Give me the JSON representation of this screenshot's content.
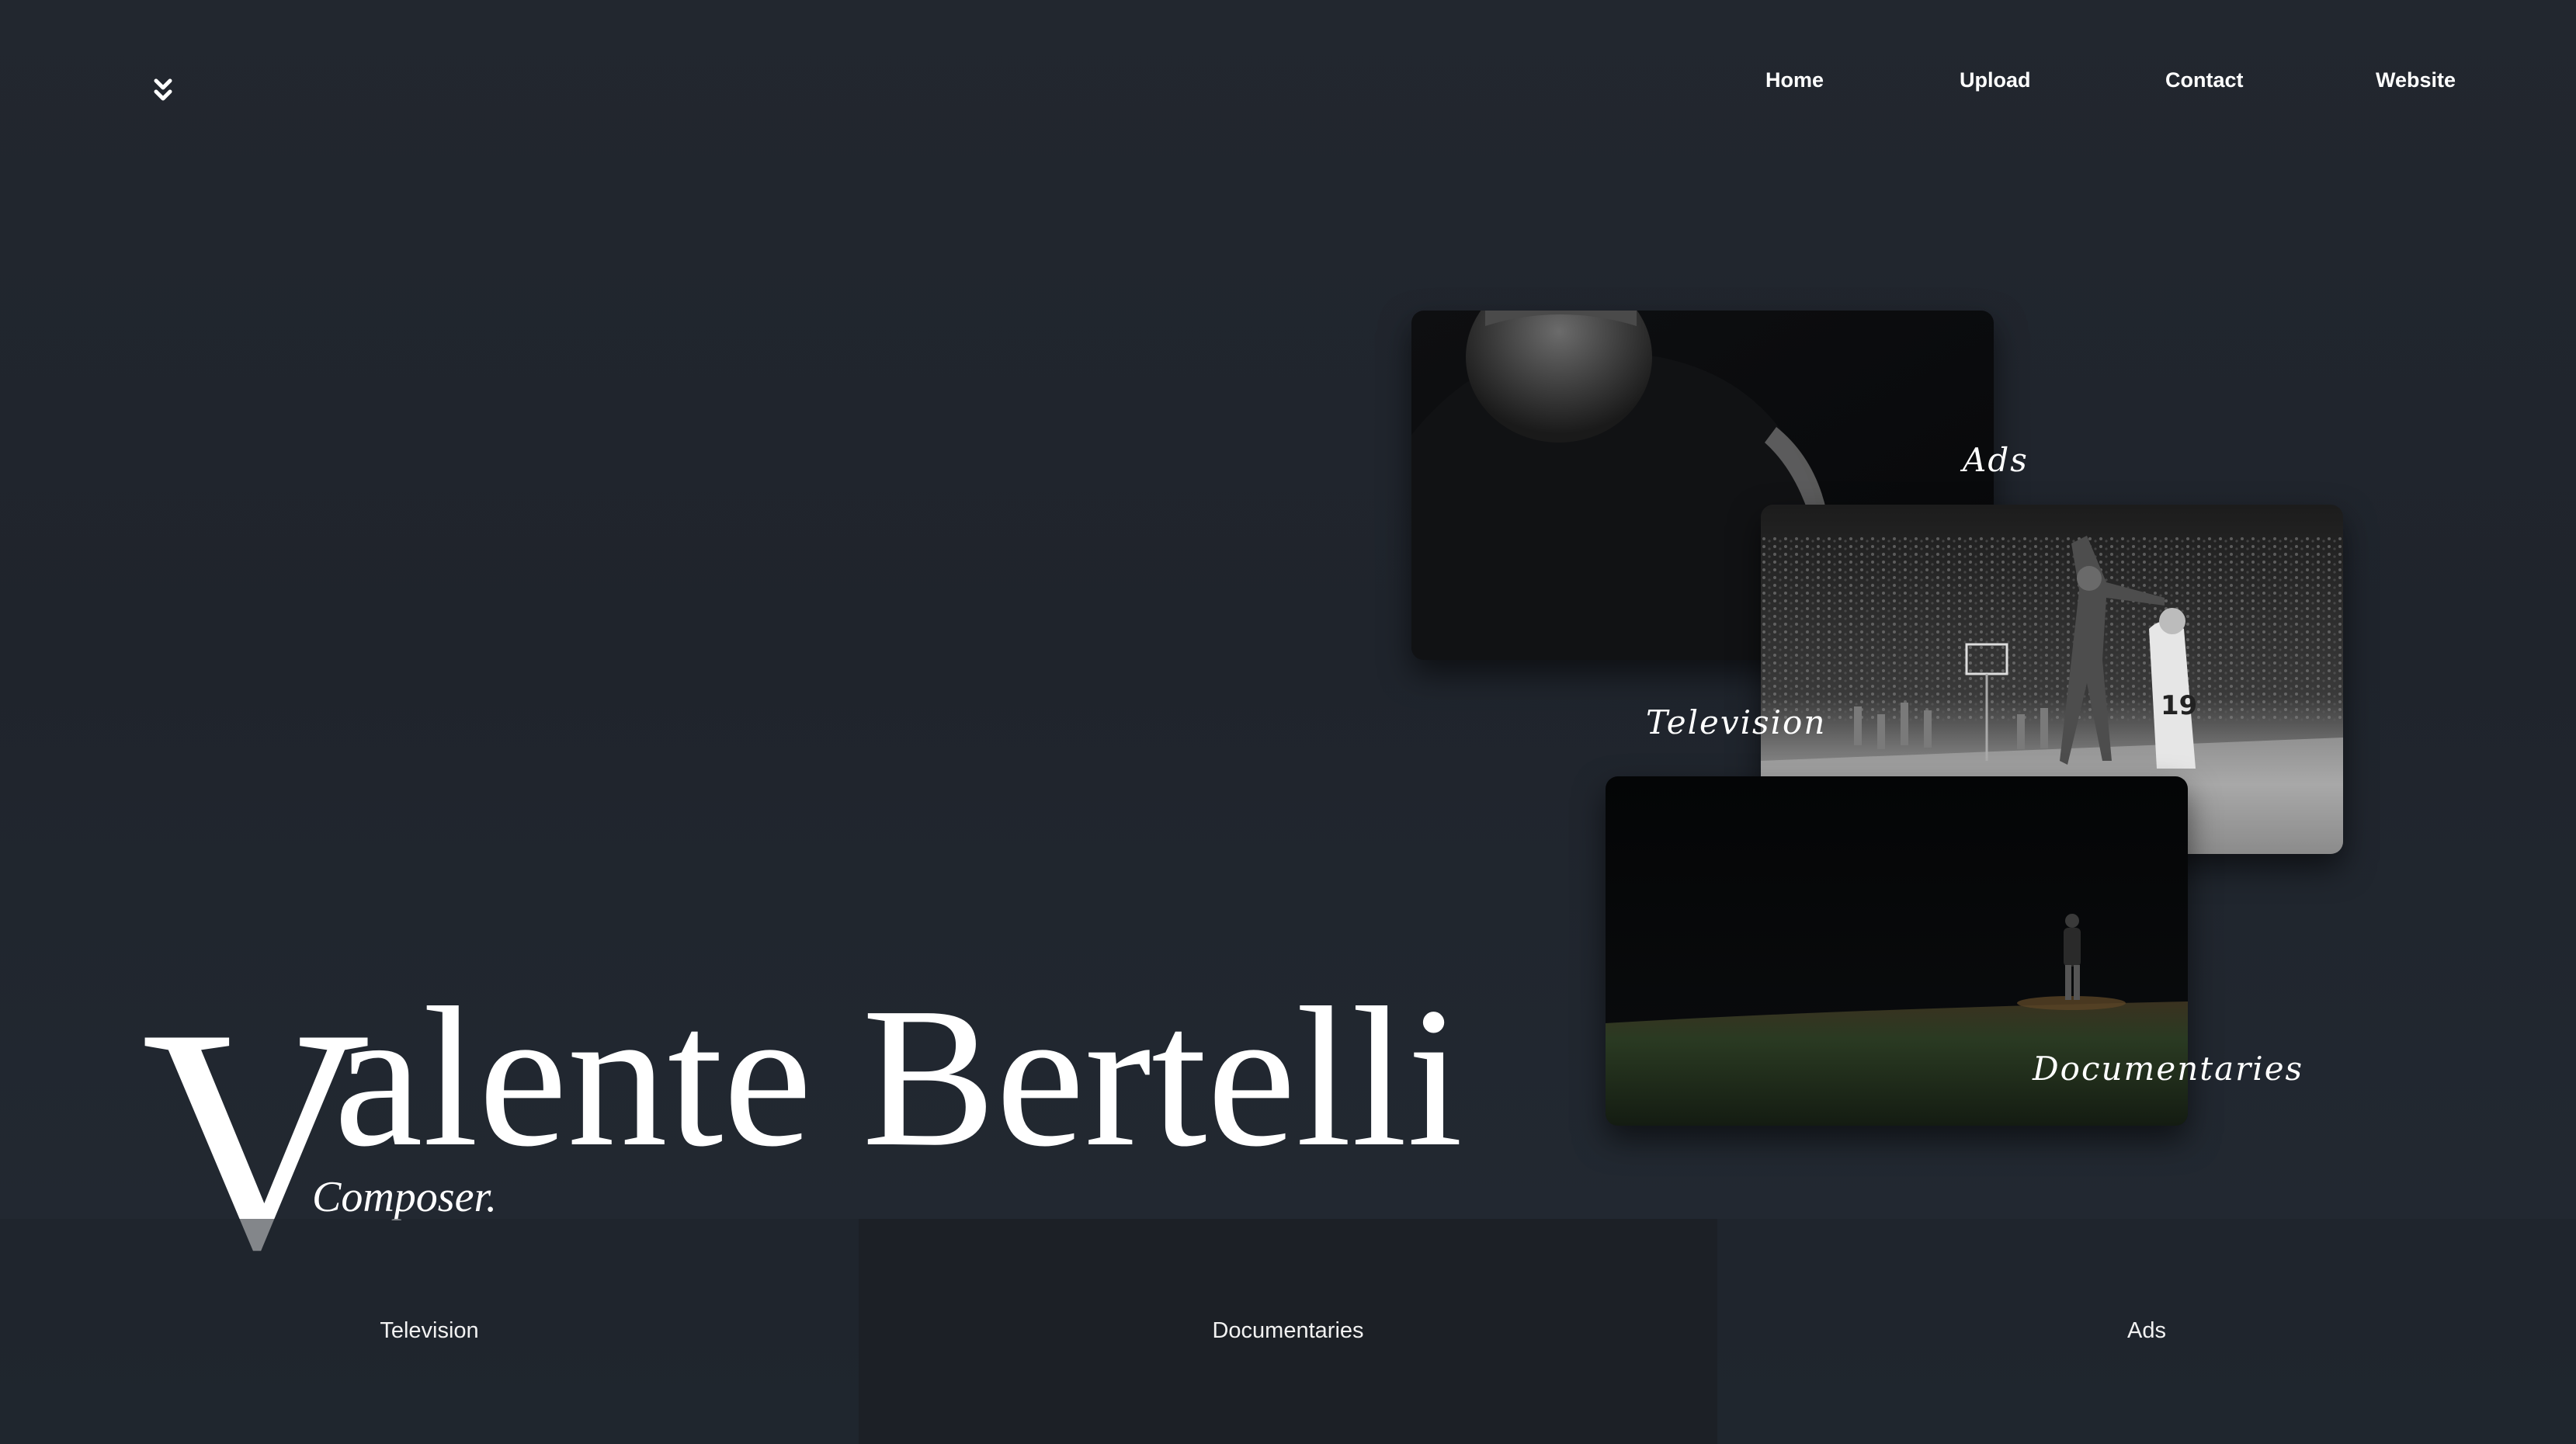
{
  "nav": {
    "logo_icon": "double-chevron-down-icon",
    "items": [
      {
        "label": "Home"
      },
      {
        "label": "Upload"
      },
      {
        "label": "Contact"
      },
      {
        "label": "Website"
      }
    ]
  },
  "cards": [
    {
      "label": "Ads",
      "image": "man-looking-down-dark-photo"
    },
    {
      "label": "Television",
      "image": "black-and-white-basketball-game-photo"
    },
    {
      "label": "Documentaries",
      "image": "baseball-pitcher-at-night-photo"
    }
  ],
  "hero": {
    "name_initial": "V",
    "name_rest": "alente Bertelli",
    "subtitle": "Composer."
  },
  "bottom_tabs": [
    {
      "label": "Television"
    },
    {
      "label": "Documentaries"
    },
    {
      "label": "Ads"
    }
  ],
  "colors": {
    "background": "#22272f",
    "text": "#ffffff"
  }
}
